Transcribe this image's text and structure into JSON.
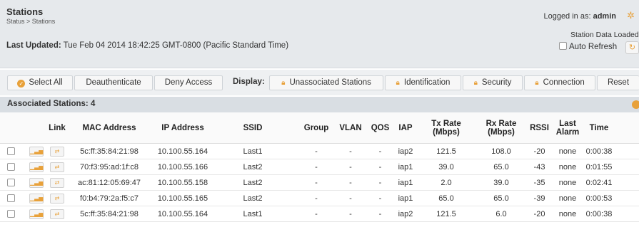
{
  "header": {
    "title": "Stations",
    "breadcrumb": "Status > Stations",
    "last_updated_label": "Last Updated:",
    "last_updated_value": "Tue Feb 04 2014 18:42:25 GMT-0800 (Pacific Standard Time)",
    "logged_in_label": "Logged in as:",
    "logged_in_user": "admin",
    "station_data_status": "Station Data Loaded",
    "auto_refresh_label": "Auto Refresh"
  },
  "toolbar": {
    "select_all": "Select All",
    "deauthenticate": "Deauthenticate",
    "deny_access": "Deny Access",
    "display_label": "Display:",
    "unassociated": "Unassociated Stations",
    "identification": "Identification",
    "security": "Security",
    "connection": "Connection",
    "reset": "Reset"
  },
  "section": {
    "title": "Associated Stations: 4"
  },
  "table": {
    "columns": {
      "link": "Link",
      "mac": "MAC Address",
      "ip": "IP Address",
      "ssid": "SSID",
      "group": "Group",
      "vlan": "VLAN",
      "qos": "QOS",
      "iap": "IAP",
      "tx_line1": "Tx Rate",
      "tx_line2": "(Mbps)",
      "rx_line1": "Rx Rate",
      "rx_line2": "(Mbps)",
      "rssi": "RSSI",
      "alarm_line1": "Last",
      "alarm_line2": "Alarm",
      "time": "Time"
    },
    "rows": [
      {
        "mac": "5c:ff:35:84:21:98",
        "ip": "10.100.55.164",
        "ssid": "Last1",
        "group": "-",
        "vlan": "-",
        "qos": "-",
        "iap": "iap2",
        "tx": "121.5",
        "rx": "108.0",
        "rssi": "-20",
        "alarm": "none",
        "time": "0:00:38"
      },
      {
        "mac": "70:f3:95:ad:1f:c8",
        "ip": "10.100.55.166",
        "ssid": "Last2",
        "group": "-",
        "vlan": "-",
        "qos": "-",
        "iap": "iap1",
        "tx": "39.0",
        "rx": "65.0",
        "rssi": "-43",
        "alarm": "none",
        "time": "0:01:55"
      },
      {
        "mac": "ac:81:12:05:69:47",
        "ip": "10.100.55.158",
        "ssid": "Last2",
        "group": "-",
        "vlan": "-",
        "qos": "-",
        "iap": "iap1",
        "tx": "2.0",
        "rx": "39.0",
        "rssi": "-35",
        "alarm": "none",
        "time": "0:02:41"
      },
      {
        "mac": "f0:b4:79:2a:f5:c7",
        "ip": "10.100.55.165",
        "ssid": "Last2",
        "group": "-",
        "vlan": "-",
        "qos": "-",
        "iap": "iap1",
        "tx": "65.0",
        "rx": "65.0",
        "rssi": "-39",
        "alarm": "none",
        "time": "0:00:53"
      },
      {
        "mac": "5c:ff:35:84:21:98",
        "ip": "10.100.55.164",
        "ssid": "Last1",
        "group": "-",
        "vlan": "-",
        "qos": "-",
        "iap": "iap2",
        "tx": "121.5",
        "rx": "6.0",
        "rssi": "-20",
        "alarm": "none",
        "time": "0:00:38"
      }
    ]
  },
  "icons": {
    "gear": "gear-icon",
    "refresh": "refresh-icon",
    "lock": "lock-icon",
    "check": "check-circle-icon",
    "signal": "signal-icon",
    "link": "link-icon",
    "collapse": "collapse-icon"
  },
  "colors": {
    "accent": "#e8a13a",
    "header_bg": "#e6e9ec",
    "section_bg": "#d9dee3"
  }
}
